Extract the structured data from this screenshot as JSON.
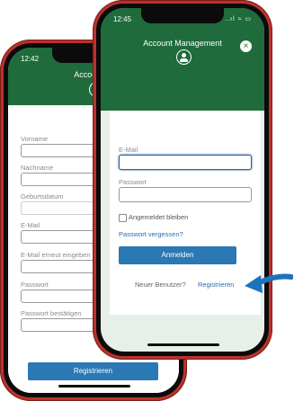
{
  "back_phone": {
    "status_time": "12:42",
    "header_title": "Account Management",
    "labels": [
      "Vorname",
      "Nachname",
      "Geburtsdatum",
      "E-Mail",
      "E-Mail erneut eingeben",
      "Passwort",
      "Passwort bestätigen"
    ],
    "submit_label": "Registrieren"
  },
  "front_phone": {
    "status_time": "12:45",
    "status_icons": "..ıl ≈ ▭",
    "header_title": "Account Management",
    "email_label": "E-Mail",
    "password_label": "Passwort",
    "remember_label": "Angemeldet bleiben",
    "forgot_password": "Passwort vergessen?",
    "login_button": "Anmelden",
    "new_user_text": "Neuer Benutzer?",
    "register_link": "Registrieren"
  },
  "colors": {
    "header_green": "#1f6b3b",
    "button_blue": "#2a78b4",
    "phone_red": "#b8332c",
    "arrow_blue": "#1e73be"
  },
  "icons": {
    "close": "close-icon",
    "account": "account-icon",
    "arrow": "pointer-arrow"
  }
}
